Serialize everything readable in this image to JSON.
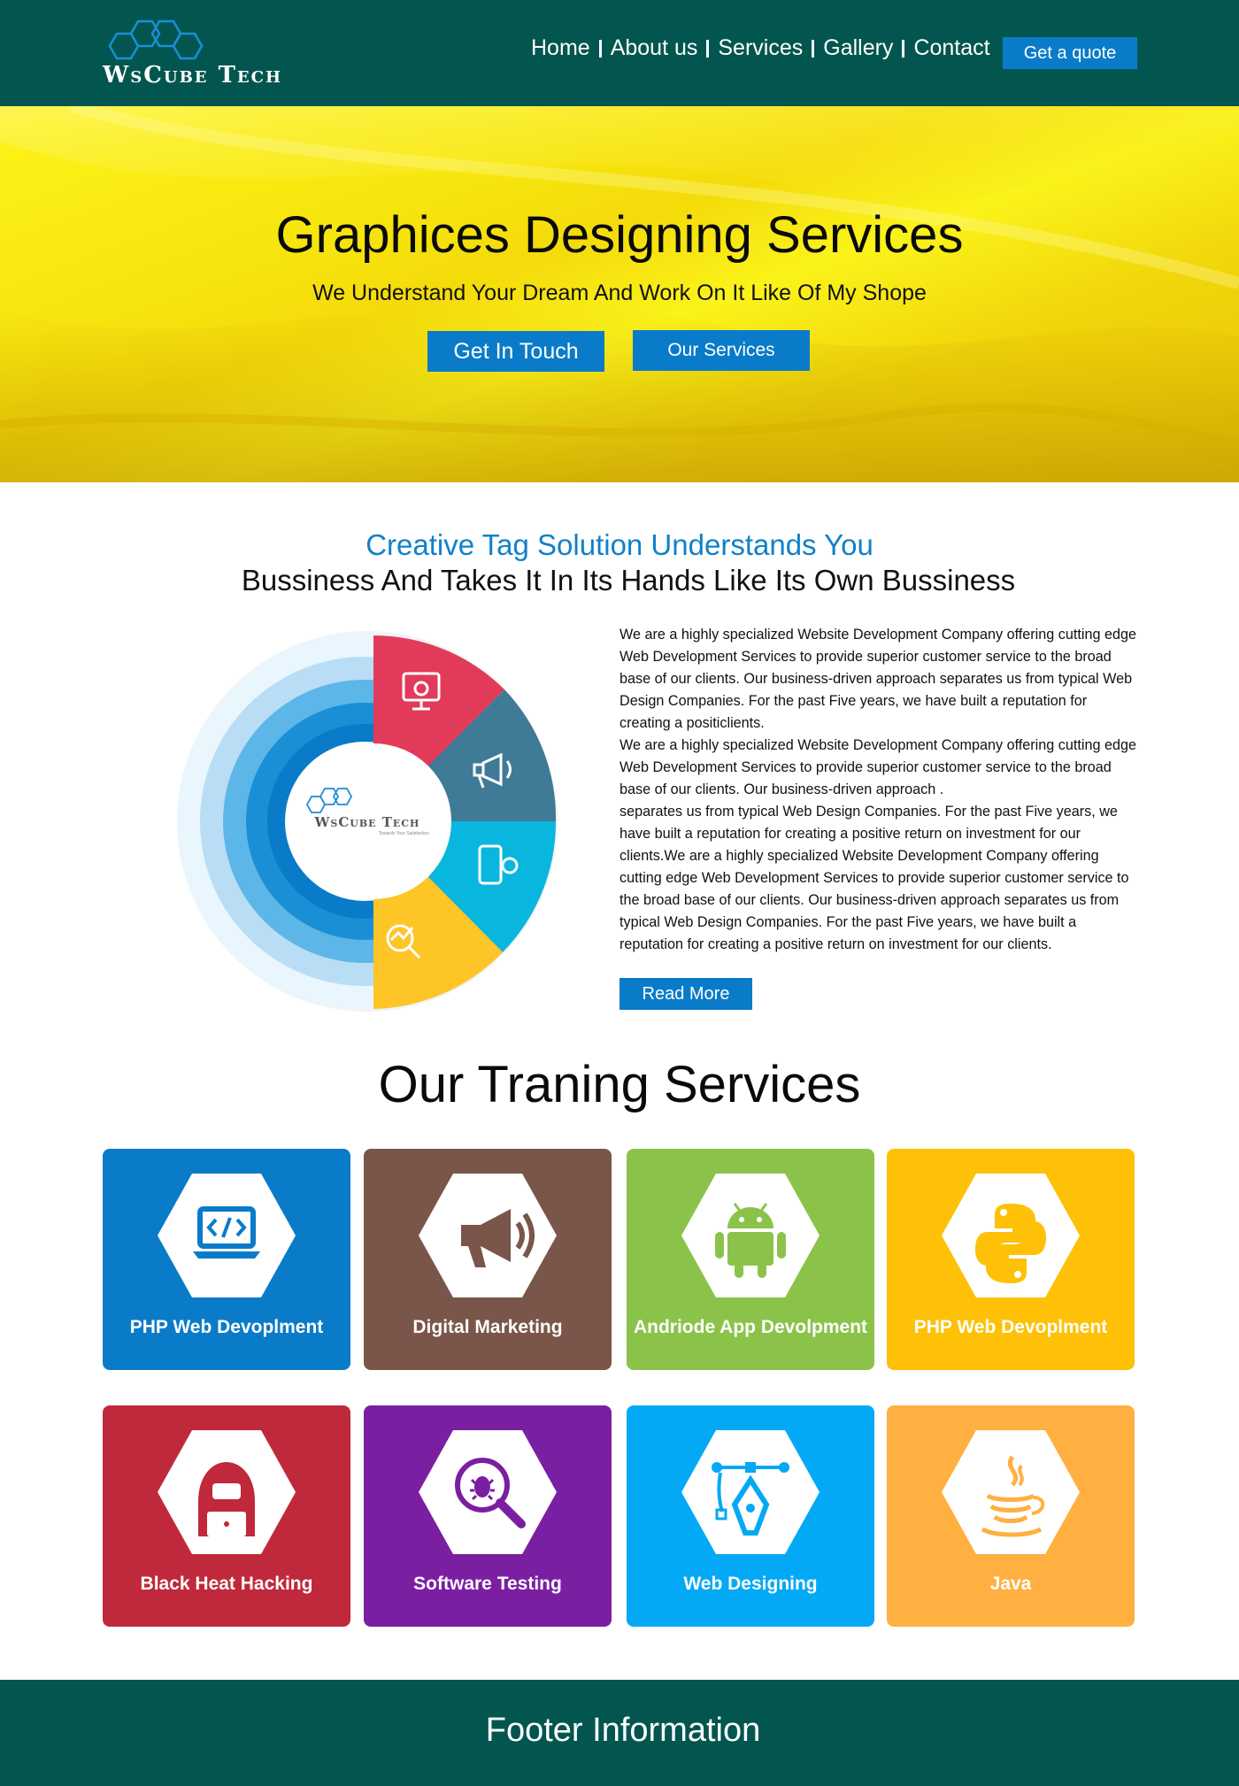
{
  "header": {
    "logo_text": "WsCube Tech",
    "nav": [
      "Home",
      "About us",
      "Services",
      "Gallery",
      "Contact"
    ],
    "quote_label": "Get a quote"
  },
  "hero": {
    "title": "Graphices Designing Services",
    "subtitle": "We Understand Your Dream And Work On It Like Of My Shope",
    "btn_touch": "Get In Touch",
    "btn_services": "Our Services"
  },
  "about": {
    "heading_line1": "Creative Tag Solution Understands You",
    "heading_line2": "Bussiness And Takes It In Its Hands Like Its Own Bussiness",
    "badge_text": "WsCube Tech",
    "badge_tagline": "Towards Your Satisfaction",
    "paragraphs": [
      "We are a highly specialized Website Development Company offering cutting edge Web Development Services to provide superior customer service to the broad base of our clients. Our business-driven approach separates us from typical Web Design Companies. For the past Five years, we have built a reputation for creating a positiclients.",
      "We are a highly specialized Website Development Company offering cutting edge Web Development Services to provide superior customer service to the broad base of our clients. Our business-driven approach .",
      "separates us from typical Web Design Companies. For the past Five years, we have built a reputation for creating a positive return on investment for our clients.We are a highly specialized Website Development Company offering cutting edge Web Development Services to provide superior customer service to the broad base of our clients. Our business-driven approach separates us from typical Web Design Companies. For the past Five years, we have built a reputation for creating a positive return on investment for our clients."
    ],
    "read_more": "Read More"
  },
  "training": {
    "title": "Our Traning Services",
    "cards": [
      {
        "label": "PHP Web Devoplment",
        "color": "#0a7bc9",
        "icon": "laptop-code-icon"
      },
      {
        "label": "Digital Marketing",
        "color": "#7a5549",
        "icon": "megaphone-icon"
      },
      {
        "label": "Andriode App Devolpment",
        "color": "#8bc34a",
        "icon": "android-icon"
      },
      {
        "label": "PHP Web Devoplment",
        "color": "#fec107",
        "icon": "python-icon"
      },
      {
        "label": "Black Heat Hacking",
        "color": "#c0293b",
        "icon": "hacker-icon"
      },
      {
        "label": "Software Testing",
        "color": "#7b1fa2",
        "icon": "bug-search-icon"
      },
      {
        "label": "Web Designing",
        "color": "#03a9f4",
        "icon": "pen-tool-icon"
      },
      {
        "label": "Java",
        "color": "#ffb040",
        "icon": "java-icon"
      }
    ]
  },
  "footer": {
    "text": "Footer Information"
  }
}
